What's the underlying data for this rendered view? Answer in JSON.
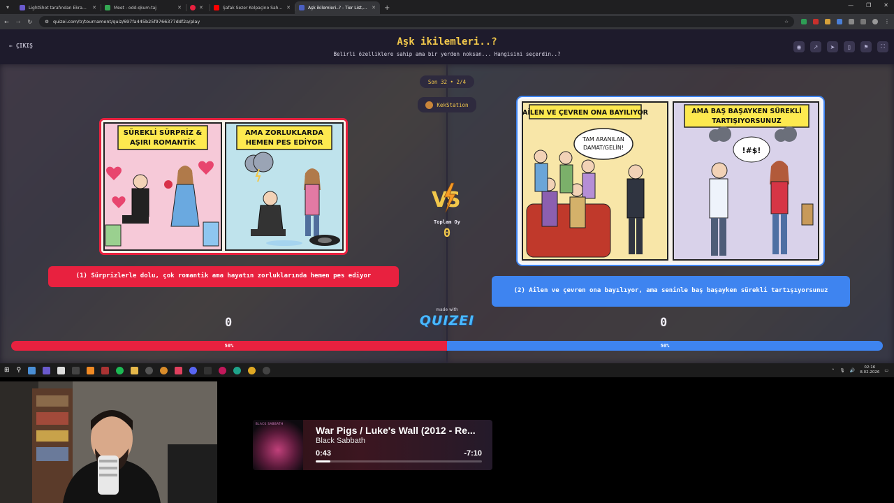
{
  "browser": {
    "tabs": [
      {
        "title": "LightShot tarafından Ekran Görü",
        "favicon_color": "#6a5acd",
        "active": false
      },
      {
        "title": "Meet - odd-qkum-taj",
        "favicon_color": "#34a853",
        "active": false
      },
      {
        "title": "",
        "favicon_color": "#e8213f",
        "active": false
      },
      {
        "title": "Şafak Sezer Kolpaçino Sahnele",
        "favicon_color": "#ff0000",
        "active": false
      },
      {
        "title": "Aşk ikilemleri..? - Tier List, Kör",
        "favicon_color": "#4a5fc1",
        "active": true
      }
    ],
    "url": "quizei.com/tr/tournament/quiz/697fa445b25f9766377ddf2a/play"
  },
  "header": {
    "exit_label": "ÇIKIŞ",
    "title": "Aşk ikilemleri..?",
    "subtitle": "Belirli özelliklere sahip ama bir yerden noksan... Hangisini seçerdin..?"
  },
  "round": {
    "label": "Son 32 • 2/4",
    "user": "KekStation"
  },
  "left_option": {
    "panel_captions": [
      "SÜREKLİ SÜRPRİZ &",
      "AŞIRI ROMANTİK",
      "AMA ZORLUKLARDA",
      "HEMEN PES EDİYOR"
    ],
    "button_text": "(1) Sürprizlerle dolu, çok romantik ama hayatın zorluklarında hemen pes ediyor",
    "score": "0",
    "percent_label": "50%",
    "percent": 50
  },
  "right_option": {
    "panel_captions": [
      "AİLEN VE ÇEVREN ONA BAYILIYOR",
      "AMA BAŞ BAŞAYKEN SÜREKLİ",
      "TARTIŞIYORSUNUZ",
      "TAM ARANILAN",
      "DAMAT/GELİN!"
    ],
    "button_text": "(2) Ailen ve çevren ona bayılıyor, ama seninle baş başayken sürekli tartışıyorsunuz",
    "score": "0",
    "percent_label": "50%",
    "percent": 50
  },
  "center": {
    "total_label": "Toplam Oy",
    "total_value": "0",
    "made_with": "made with",
    "brand": "QUIZEI"
  },
  "taskbar": {
    "time": "02:16",
    "date": "8.02.2026"
  },
  "music": {
    "album_text": "BLACK SABBATH",
    "title": "War Pigs / Luke's Wall (2012 - Re...",
    "artist": "Black Sabbath",
    "elapsed": "0:43",
    "remaining": "-7:10",
    "progress": 0.09
  },
  "colors": {
    "accent_yellow": "#f2c84b",
    "option_red": "#e8213f",
    "option_blue": "#3e84f0"
  }
}
